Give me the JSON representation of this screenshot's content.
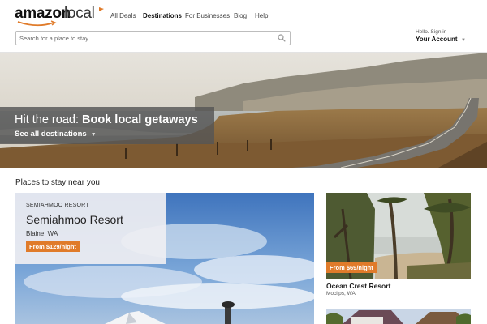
{
  "header": {
    "logo": {
      "word1": "amazon",
      "word2": "local"
    },
    "nav": [
      {
        "label": "All Deals",
        "active": false
      },
      {
        "label": "Destinations",
        "active": true
      },
      {
        "label": "For Businesses",
        "active": false
      },
      {
        "label": "Blog",
        "active": false
      },
      {
        "label": "Help",
        "active": false
      }
    ],
    "search": {
      "placeholder": "Search for a place to stay",
      "icon": "search-icon"
    },
    "account": {
      "greeting": "Hello. Sign in",
      "label": "Your Account"
    }
  },
  "hero": {
    "title_lead": "Hit the road: ",
    "title_bold": "Book local getaways",
    "link": "See all destinations"
  },
  "section": {
    "title": "Places to stay near you"
  },
  "featured": {
    "kicker": "SEMIAHMOO RESORT",
    "name": "Semiahmoo Resort",
    "location": "Blaine, WA",
    "price": "From $129/night"
  },
  "cards": [
    {
      "price": "From $69/night",
      "name": "Ocean Crest Resort",
      "location": "Moclips, WA"
    }
  ],
  "colors": {
    "accent": "#e07b2a",
    "overlay": "#555555"
  }
}
